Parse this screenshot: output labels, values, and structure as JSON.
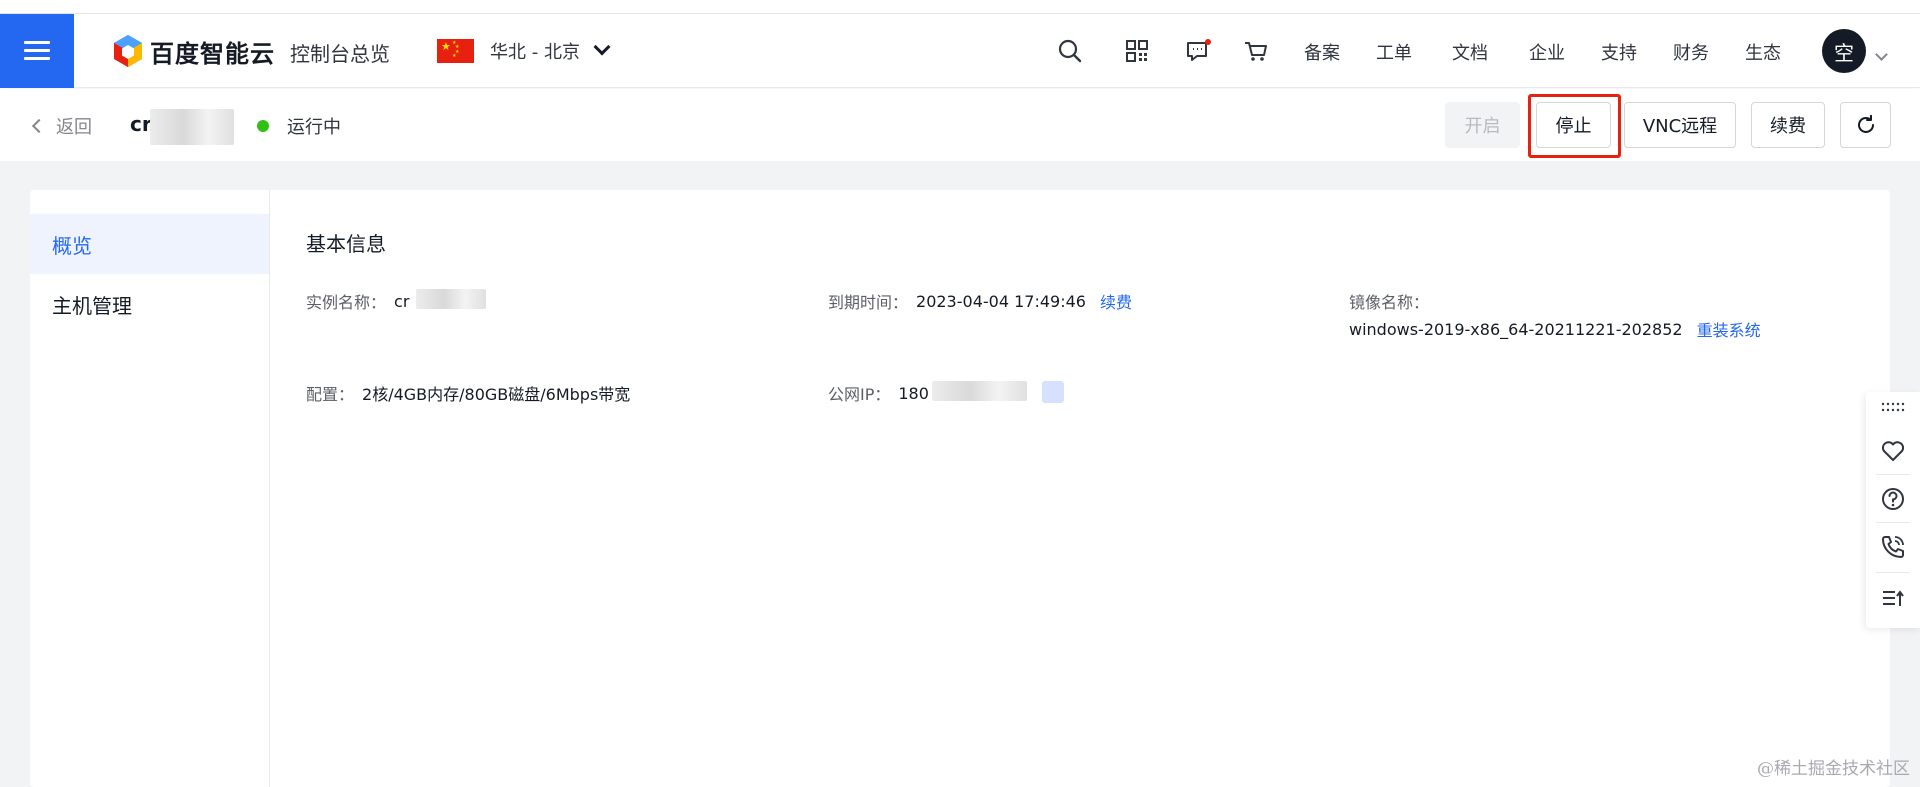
{
  "header": {
    "brand": "百度智能云",
    "console_title": "控制台总览",
    "region": "华北 - 北京",
    "nav_links": [
      "备案",
      "工单",
      "文档",
      "企业",
      "支持",
      "财务",
      "生态"
    ],
    "avatar_text": "空",
    "accent_color": "#2468f2"
  },
  "subheader": {
    "back_label": "返回",
    "instance_name": "cr",
    "status_label": "运行中",
    "status_color": "#30bf13",
    "buttons": {
      "start": "开启",
      "stop": "停止",
      "vnc": "VNC远程",
      "renew": "续费"
    }
  },
  "sidebar": {
    "items": [
      {
        "label": "概览",
        "active": true
      },
      {
        "label": "主机管理",
        "active": false
      }
    ]
  },
  "basic_info": {
    "title": "基本信息",
    "instance_name_key": "实例名称：",
    "instance_name_val": "cr",
    "expire_key": "到期时间：",
    "expire_val": "2023-04-04 17:49:46",
    "expire_action": "续费",
    "image_key": "镜像名称：",
    "image_val": "windows-2019-x86_64-20211221-202852",
    "image_action": "重装系统",
    "config_key": "配置：",
    "config_val": "2核/4GB内存/80GB磁盘/6Mbps带宽",
    "ip_key": "公网IP：",
    "ip_val": "180"
  },
  "watermark": "@稀土掘金技术社区"
}
